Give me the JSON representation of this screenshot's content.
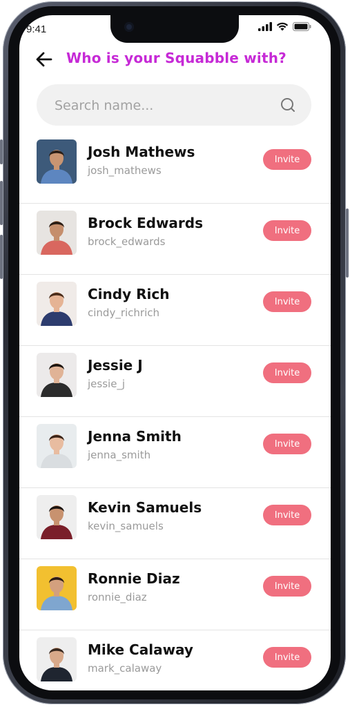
{
  "status_bar": {
    "time": "9:41"
  },
  "header": {
    "title": "Who is your Squabble with?"
  },
  "search": {
    "placeholder": "Search name..."
  },
  "invite_label": "Invite",
  "colors": {
    "accent_title": "#c62ad6",
    "invite_button": "#f06f7f"
  },
  "contacts": [
    {
      "name": "Josh Mathews",
      "username": "josh_mathews",
      "avatar_bg": "#3d5a7a",
      "shirt": "#5d86c0",
      "skin": "#c89572",
      "hair": "#2a1e16"
    },
    {
      "name": "Brock Edwards",
      "username": "brock_edwards",
      "avatar_bg": "#e7e4e1",
      "shirt": "#d9675f",
      "skin": "#c58e6c",
      "hair": "#2b1d14"
    },
    {
      "name": "Cindy Rich",
      "username": "cindy_richrich",
      "avatar_bg": "#f0ebe8",
      "shirt": "#2d3c6e",
      "skin": "#e5b394",
      "hair": "#4a2c1a"
    },
    {
      "name": "Jessie J",
      "username": "jessie_j",
      "avatar_bg": "#eceaea",
      "shirt": "#2c2c2c",
      "skin": "#e0b396",
      "hair": "#1e1610"
    },
    {
      "name": "Jenna Smith",
      "username": "jenna_smith",
      "avatar_bg": "#e8ecee",
      "shirt": "#d9dde0",
      "skin": "#e8bca0",
      "hair": "#3b2418"
    },
    {
      "name": "Kevin Samuels",
      "username": "kevin_samuels",
      "avatar_bg": "#eeeeee",
      "shirt": "#7a1f2a",
      "skin": "#c8926f",
      "hair": "#1c1410"
    },
    {
      "name": "Ronnie Diaz",
      "username": "ronnie_diaz",
      "avatar_bg": "#f2c030",
      "shirt": "#7fa6cf",
      "skin": "#d3a07e",
      "hair": "#2c1d14"
    },
    {
      "name": "Mike Calaway",
      "username": "mark_calaway",
      "avatar_bg": "#eeeeee",
      "shirt": "#1f2530",
      "skin": "#d8a98a",
      "hair": "#3a2a20"
    }
  ]
}
